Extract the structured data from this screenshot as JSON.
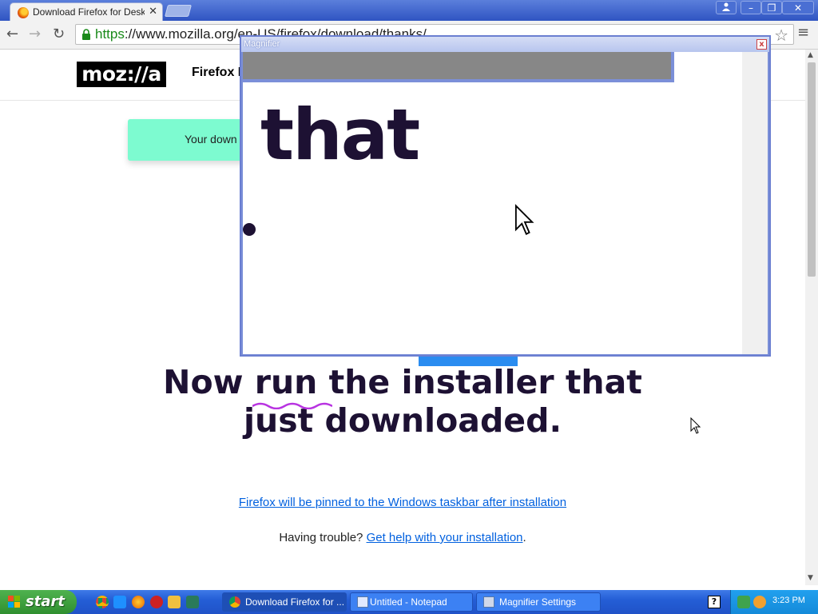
{
  "browser": {
    "tab_title": "Download Firefox for Desktop",
    "tab_close": "✕",
    "url_scheme": "https",
    "url_rest": "://www.mozilla.org/en-US/firefox/download/thanks/"
  },
  "site": {
    "logo": "moz://a",
    "nav_firefox": "Firefox B",
    "banner_text": "Your down"
  },
  "headline": {
    "line1": "Now run the installer that",
    "line2": "just downloaded."
  },
  "links": {
    "pinned": "Firefox will be pinned to the Windows taskbar after installation",
    "trouble_prefix": "Having trouble?",
    "trouble_link": "Get help with your installation",
    "trouble_suffix": "."
  },
  "magnifier": {
    "title": "Magnifier",
    "close": "x",
    "magnified_word": "that"
  },
  "taskbar": {
    "start": "start",
    "tasks": [
      {
        "label": "Download Firefox for ..."
      },
      {
        "label": "Untitled - Notepad"
      },
      {
        "label": "Magnifier Settings"
      }
    ],
    "help": "?",
    "clock": "3:23 PM"
  },
  "colors": {
    "accent_blue": "#0060df",
    "banner_green": "#7dfbd0",
    "headline_ink": "#1d1133",
    "xp_taskbar": "#245ed6"
  }
}
